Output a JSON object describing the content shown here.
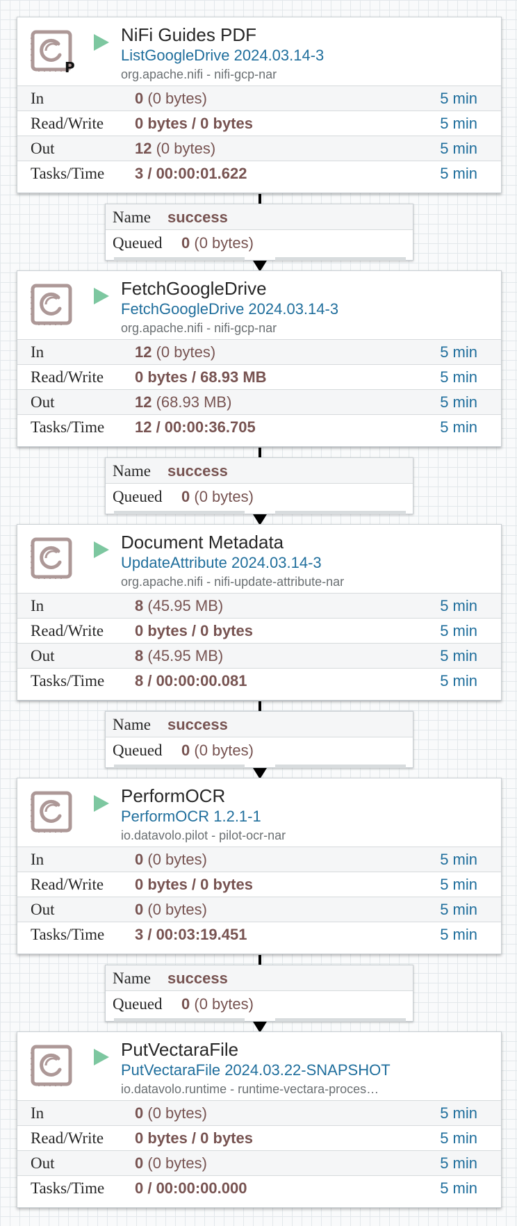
{
  "processors": [
    {
      "name": "NiFi Guides PDF",
      "type": "ListGoogleDrive 2024.03.14-3",
      "bundle": "org.apache.nifi - nifi-gcp-nar",
      "primary_badge": "P",
      "stats": {
        "in": {
          "label": "In",
          "value": "0",
          "detail": "(0 bytes)",
          "period": "5 min"
        },
        "read_write": {
          "label": "Read/Write",
          "value": "0 bytes / 0 bytes",
          "period": "5 min"
        },
        "out": {
          "label": "Out",
          "value": "12",
          "detail": "(0 bytes)",
          "period": "5 min"
        },
        "tasks_time": {
          "label": "Tasks/Time",
          "value": "3 / 00:00:01.622",
          "period": "5 min"
        }
      }
    },
    {
      "name": "FetchGoogleDrive",
      "type": "FetchGoogleDrive 2024.03.14-3",
      "bundle": "org.apache.nifi - nifi-gcp-nar",
      "stats": {
        "in": {
          "label": "In",
          "value": "12",
          "detail": "(0 bytes)",
          "period": "5 min"
        },
        "read_write": {
          "label": "Read/Write",
          "value": "0 bytes / 68.93 MB",
          "period": "5 min"
        },
        "out": {
          "label": "Out",
          "value": "12",
          "detail": "(68.93 MB)",
          "period": "5 min"
        },
        "tasks_time": {
          "label": "Tasks/Time",
          "value": "12 / 00:00:36.705",
          "period": "5 min"
        }
      }
    },
    {
      "name": "Document Metadata",
      "type": "UpdateAttribute 2024.03.14-3",
      "bundle": "org.apache.nifi - nifi-update-attribute-nar",
      "stats": {
        "in": {
          "label": "In",
          "value": "8",
          "detail": "(45.95 MB)",
          "period": "5 min"
        },
        "read_write": {
          "label": "Read/Write",
          "value": "0 bytes / 0 bytes",
          "period": "5 min"
        },
        "out": {
          "label": "Out",
          "value": "8",
          "detail": "(45.95 MB)",
          "period": "5 min"
        },
        "tasks_time": {
          "label": "Tasks/Time",
          "value": "8 / 00:00:00.081",
          "period": "5 min"
        }
      }
    },
    {
      "name": "PerformOCR",
      "type": "PerformOCR 1.2.1-1",
      "bundle": "io.datavolo.pilot - pilot-ocr-nar",
      "stats": {
        "in": {
          "label": "In",
          "value": "0",
          "detail": "(0 bytes)",
          "period": "5 min"
        },
        "read_write": {
          "label": "Read/Write",
          "value": "0 bytes / 0 bytes",
          "period": "5 min"
        },
        "out": {
          "label": "Out",
          "value": "0",
          "detail": "(0 bytes)",
          "period": "5 min"
        },
        "tasks_time": {
          "label": "Tasks/Time",
          "value": "3 / 00:03:19.451",
          "period": "5 min"
        }
      }
    },
    {
      "name": "PutVectaraFile",
      "type": "PutVectaraFile 2024.03.22-SNAPSHOT",
      "bundle": "io.datavolo.runtime - runtime-vectara-proces…",
      "stats": {
        "in": {
          "label": "In",
          "value": "0",
          "detail": "(0 bytes)",
          "period": "5 min"
        },
        "read_write": {
          "label": "Read/Write",
          "value": "0 bytes / 0 bytes",
          "period": "5 min"
        },
        "out": {
          "label": "Out",
          "value": "0",
          "detail": "(0 bytes)",
          "period": "5 min"
        },
        "tasks_time": {
          "label": "Tasks/Time",
          "value": "0 / 00:00:00.000",
          "period": "5 min"
        }
      }
    }
  ],
  "connections": [
    {
      "name_label": "Name",
      "name": "success",
      "queued_label": "Queued",
      "queued_value": "0",
      "queued_detail": "(0 bytes)"
    },
    {
      "name_label": "Name",
      "name": "success",
      "queued_label": "Queued",
      "queued_value": "0",
      "queued_detail": "(0 bytes)"
    },
    {
      "name_label": "Name",
      "name": "success",
      "queued_label": "Queued",
      "queued_value": "0",
      "queued_detail": "(0 bytes)"
    },
    {
      "name_label": "Name",
      "name": "success",
      "queued_label": "Queued",
      "queued_value": "0",
      "queued_detail": "(0 bytes)"
    }
  ],
  "colors": {
    "run_state": "#7dc7a0",
    "processor_icon": "#ad9897",
    "type_link": "#1f6e9c",
    "stat_value": "#775351"
  },
  "icons": {
    "processor": "processor-icon",
    "run_state": "play-icon"
  }
}
